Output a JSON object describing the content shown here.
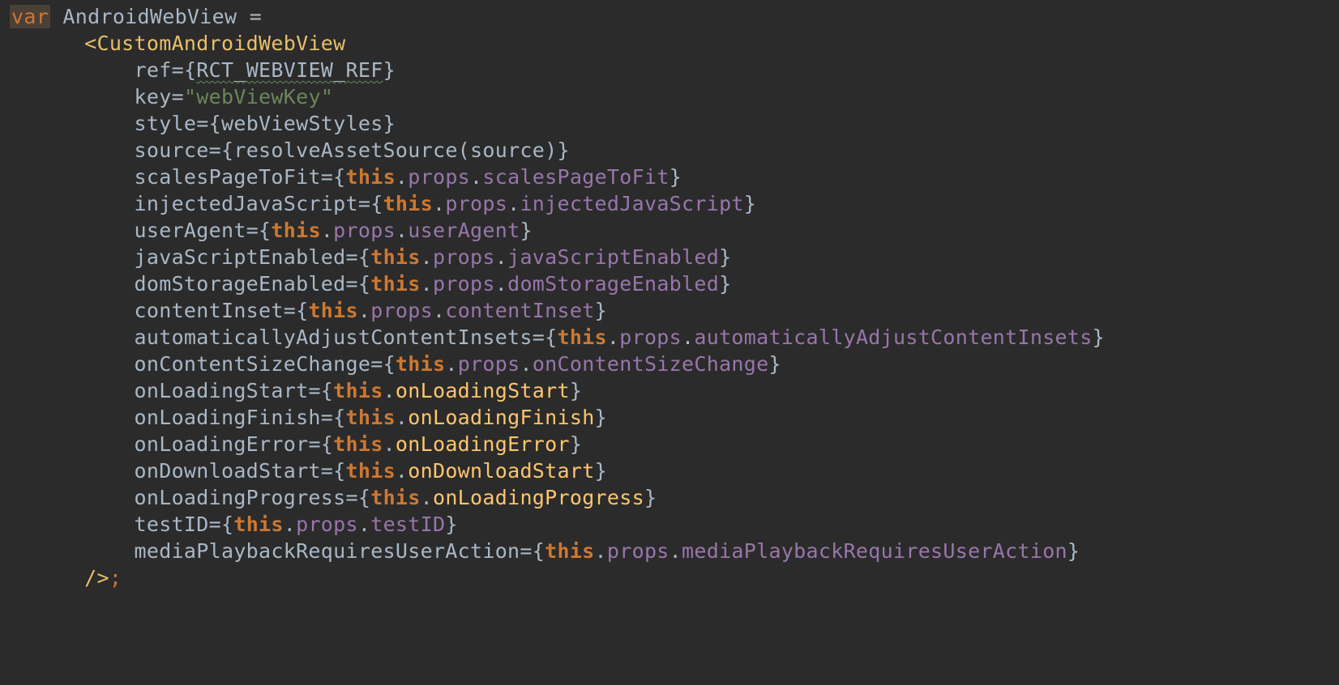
{
  "colors": {
    "background": "#2b2b2b",
    "default": "#a9b7c6",
    "keyword": "#cc7832",
    "keyword_highlight_bg": "#4a4036",
    "tag": "#e8bf6a",
    "property": "#9876aa",
    "method": "#ffc66d",
    "string": "#6a8759"
  },
  "t": {
    "var": "var",
    "varName": "AndroidWebView",
    "eq": " =",
    "lt": "<",
    "gt": ">",
    "slashGt": "/>",
    "semicolon": ";",
    "ob": "{",
    "cb": "}",
    "op": "(",
    "cp": ")",
    "dot": ".",
    "eqSign": "=",
    "dq": "\"",
    "this": "this",
    "props": "props",
    "tagName": "CustomAndroidWebView",
    "attrs": {
      "ref": "ref",
      "refVal": "RCT_WEBVIEW_REF",
      "key": "key",
      "keyVal": "webViewKey",
      "style": "style",
      "styleVal": "webViewStyles",
      "source": "source",
      "sourceFn": "resolveAssetSource",
      "sourceArg": "source",
      "scalesPageToFit": "scalesPageToFit",
      "injectedJavaScript": "injectedJavaScript",
      "userAgent": "userAgent",
      "javaScriptEnabled": "javaScriptEnabled",
      "domStorageEnabled": "domStorageEnabled",
      "contentInset": "contentInset",
      "automaticallyAdjustContentInsets": "automaticallyAdjustContentInsets",
      "onContentSizeChange": "onContentSizeChange",
      "onLoadingStart": "onLoadingStart",
      "onLoadingFinish": "onLoadingFinish",
      "onLoadingError": "onLoadingError",
      "onDownloadStart": "onDownloadStart",
      "onLoadingProgress": "onLoadingProgress",
      "testID": "testID",
      "mediaPlaybackRequiresUserAction": "mediaPlaybackRequiresUserAction"
    }
  }
}
